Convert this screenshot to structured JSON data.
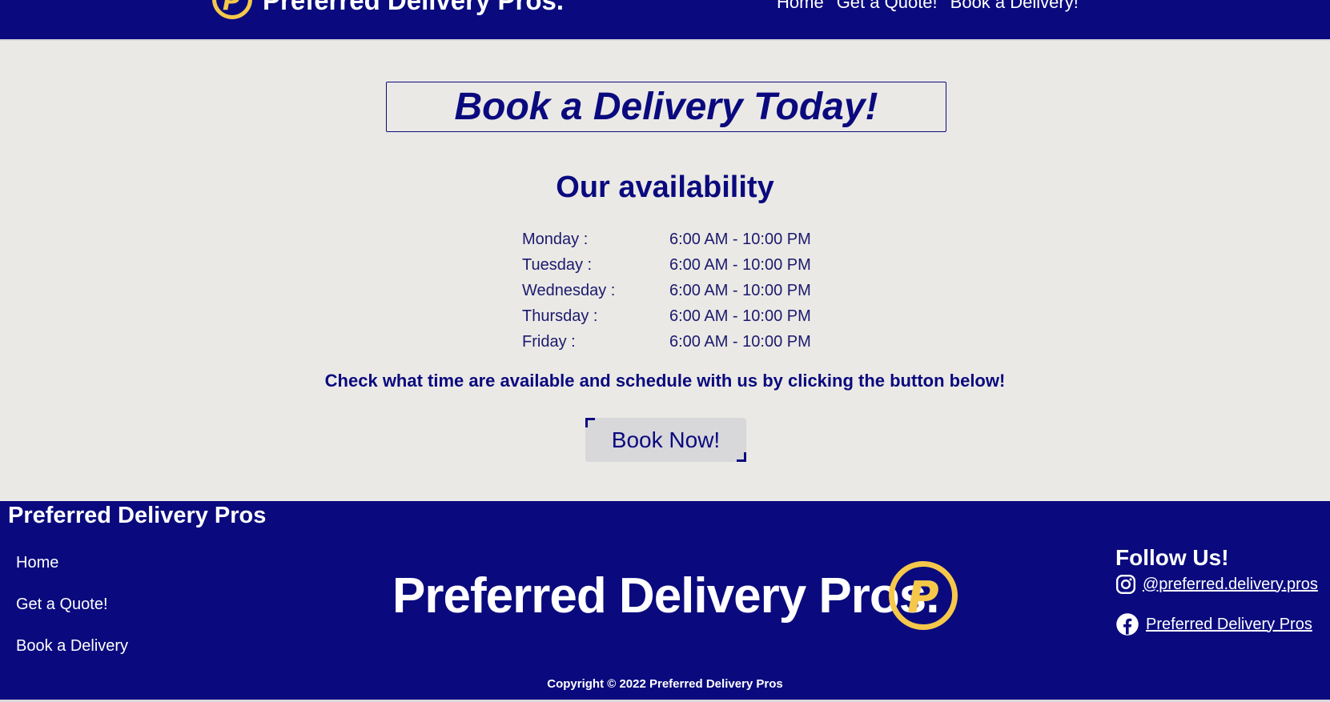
{
  "header": {
    "logo_letter": "P",
    "brand": "Preferred Delivery Pros.",
    "nav": [
      "Home",
      "Get a Quote!",
      "Book a Delivery!"
    ]
  },
  "hero": {
    "title": "Book a Delivery Today!"
  },
  "availability": {
    "title": "Our availability",
    "hours": [
      {
        "day": "Monday :",
        "time": "6:00 AM - 10:00 PM"
      },
      {
        "day": "Tuesday :",
        "time": "6:00 AM - 10:00 PM"
      },
      {
        "day": "Wednesday :",
        "time": "6:00 AM - 10:00 PM"
      },
      {
        "day": "Thursday :",
        "time": "6:00 AM - 10:00 PM"
      },
      {
        "day": "Friday :",
        "time": "6:00 AM - 10:00 PM"
      }
    ],
    "cta_text": "Check what time are available and schedule with us by clicking the button below!",
    "button_label": "Book Now!"
  },
  "footer": {
    "brand": "Preferred Delivery Pros",
    "links": [
      "Home",
      "Get a Quote!",
      "Book a Delivery"
    ],
    "logo_text": "Preferred Delivery Pros.",
    "logo_letter": "P",
    "follow_title": "Follow Us!",
    "instagram": "@preferred.delivery.pros",
    "facebook": "Preferred Delivery Pros",
    "copyright": "Copyright © 2022 Preferred Delivery Pros"
  },
  "colors": {
    "primary": "#0a0a7e",
    "accent": "#f6c84a",
    "background": "#ebe9e5",
    "button": "#d8d7da"
  },
  "icons": [
    "instagram-icon",
    "facebook-icon",
    "logo-p-icon"
  ]
}
